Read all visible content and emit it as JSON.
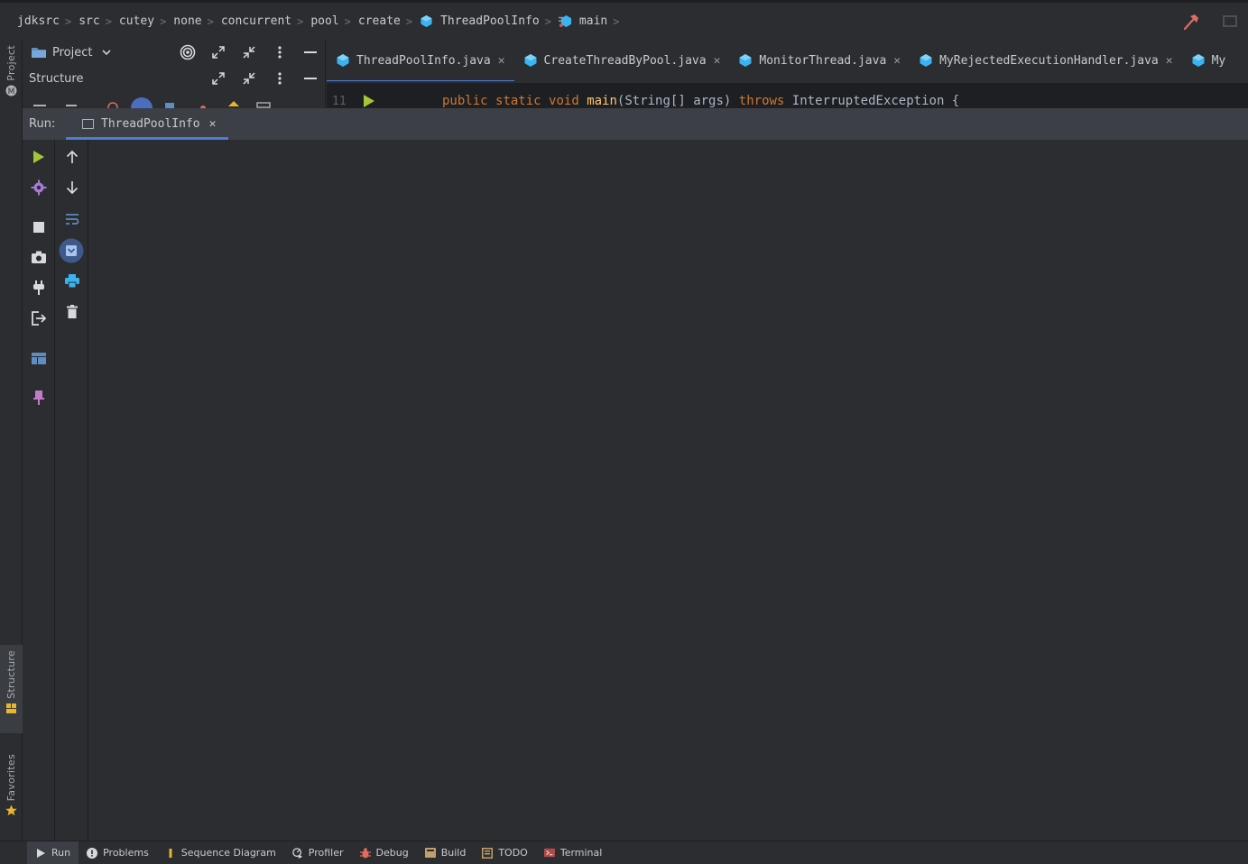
{
  "breadcrumb": {
    "items": [
      {
        "label": "jdksrc"
      },
      {
        "label": "src"
      },
      {
        "label": "cutey"
      },
      {
        "label": "none"
      },
      {
        "label": "concurrent"
      },
      {
        "label": "pool"
      },
      {
        "label": "create"
      },
      {
        "label": "ThreadPoolInfo",
        "icon": "java-class-icon"
      },
      {
        "label": "main",
        "icon": "method-icon"
      }
    ]
  },
  "nav_right": {
    "build_icon": "hammer-icon",
    "window_icon": "restore-window-icon"
  },
  "left_strip": {
    "project_label": "Project",
    "structure_label": "Structure",
    "favorites_label": "Favorites"
  },
  "side_panel": {
    "project_title": "Project",
    "structure_title": "Structure"
  },
  "editor": {
    "tabs": [
      {
        "label": "ThreadPoolInfo.java",
        "active": true
      },
      {
        "label": "CreateThreadByPool.java",
        "active": false
      },
      {
        "label": "MonitorThread.java",
        "active": false
      },
      {
        "label": "MyRejectedExecutionHandler.java",
        "active": false
      },
      {
        "label": "My",
        "active": false
      }
    ],
    "line_number": "11",
    "code": {
      "mod1": "public",
      "mod2": "static",
      "type": "void",
      "name": "main",
      "params": "(String[] args)",
      "throws": "throws",
      "exception": "InterruptedException {"
    }
  },
  "run": {
    "label": "Run:",
    "tab_label": "ThreadPoolInfo"
  },
  "bottom_bar": {
    "items": [
      {
        "label": "Run",
        "icon": "run-icon",
        "active": true
      },
      {
        "label": "Problems",
        "icon": "problems-icon"
      },
      {
        "label": "Sequence Diagram",
        "icon": "sequence-diagram-icon"
      },
      {
        "label": "Profiler",
        "icon": "profiler-icon"
      },
      {
        "label": "Debug",
        "icon": "debug-icon"
      },
      {
        "label": "Build",
        "icon": "build-icon"
      },
      {
        "label": "TODO",
        "icon": "todo-icon"
      },
      {
        "label": "Terminal",
        "icon": "terminal-icon"
      }
    ]
  },
  "colors": {
    "accent": "#4b7fd6",
    "run_green": "#a4c639",
    "java_class": "#3ab3f0",
    "background": "#2b2d30"
  }
}
